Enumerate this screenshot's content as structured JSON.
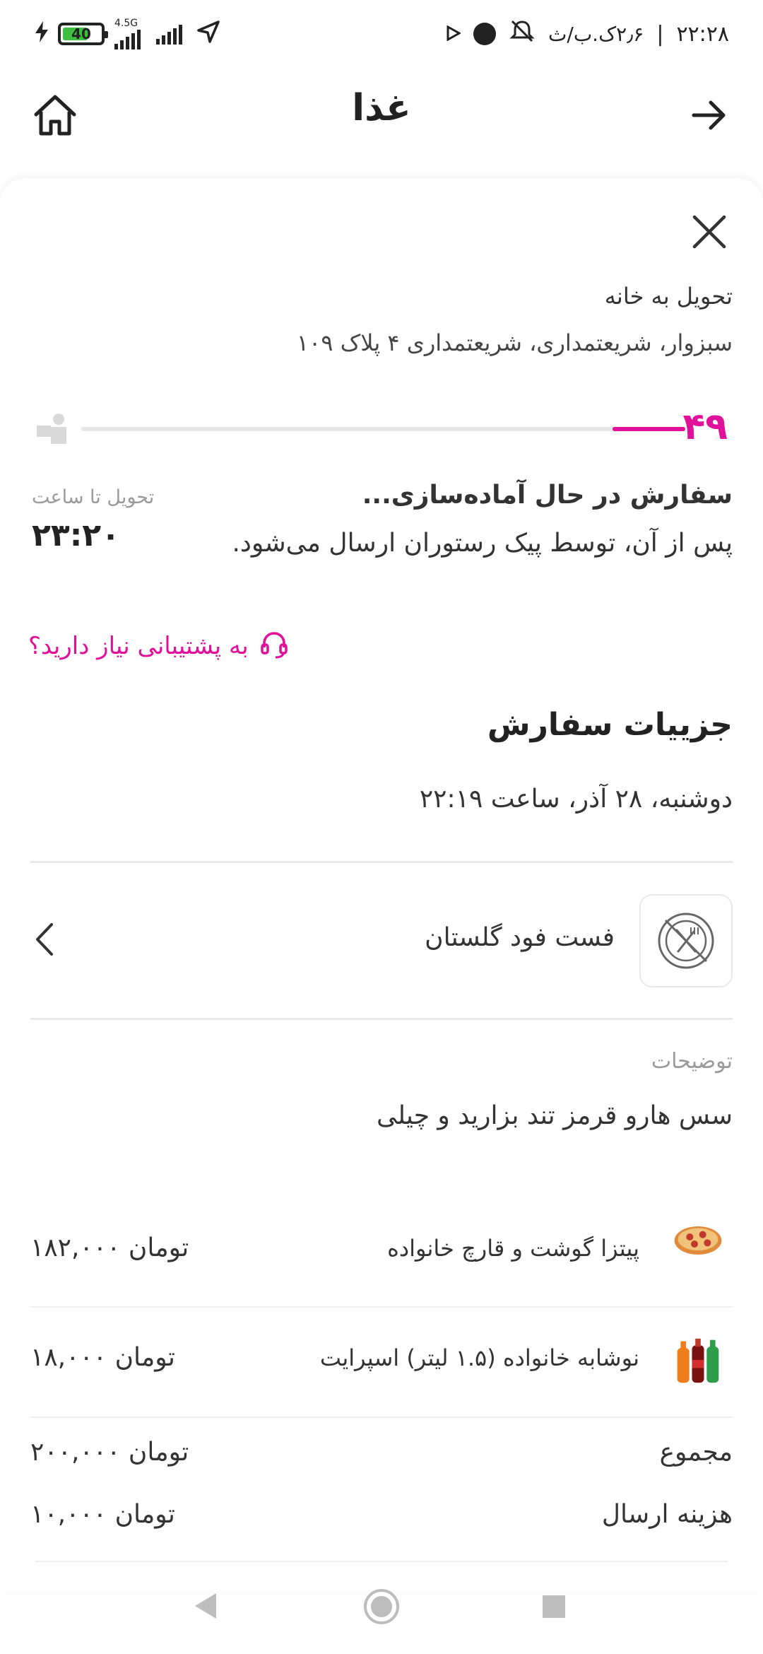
{
  "status_bar": {
    "time": "۲۲:۲۸",
    "speed": "۲٫۶ک.ب/ث",
    "separator": "|",
    "battery": "40",
    "network_type": "4.5G"
  },
  "header": {
    "title": "غذا",
    "home_icon": "home-icon",
    "back_icon": "arrow-right-icon"
  },
  "delivery": {
    "type": "تحویل به خانه",
    "address": "سبزوار، شریعتمداری، شریعتمداری ۴ پلاک ۱۰۹",
    "minutes": "۴۹",
    "progress": 0.12
  },
  "order_status": {
    "title": "سفارش در حال آماده‌سازی...",
    "subtitle": "پس از آن، توسط پیک رستوران ارسال می‌شود.",
    "eta_label": "تحویل تا ساعت",
    "eta_time": "۲۳:۲۰"
  },
  "support": {
    "label": "به پشتیبانی نیاز دارید؟"
  },
  "details": {
    "title": "جزییات سفارش",
    "date": "دوشنبه، ۲۸ آذر، ساعت ۲۲:۱۹"
  },
  "restaurant": {
    "name": "فست فود گلستان"
  },
  "notes": {
    "label": "توضیحات",
    "text": "سس هارو قرمز تند بزارید و چیلی"
  },
  "items": [
    {
      "name": "پیتزا گوشت و قارچ خانواده",
      "price": "۱۸۲,۰۰۰ تومان",
      "icon": "pizza-icon"
    },
    {
      "name": "نوشابه خانواده (۱.۵ لیتر) اسپرایت",
      "price": "۱۸,۰۰۰ تومان",
      "icon": "soda-bottles-icon"
    }
  ],
  "totals": {
    "subtotal_label": "مجموع",
    "subtotal_value": "۲۰۰,۰۰۰ تومان",
    "delivery_label": "هزینه ارسال",
    "delivery_value": "۱۰,۰۰۰ تومان"
  },
  "colors": {
    "accent": "#e0109a",
    "muted": "#9a9a9a"
  }
}
